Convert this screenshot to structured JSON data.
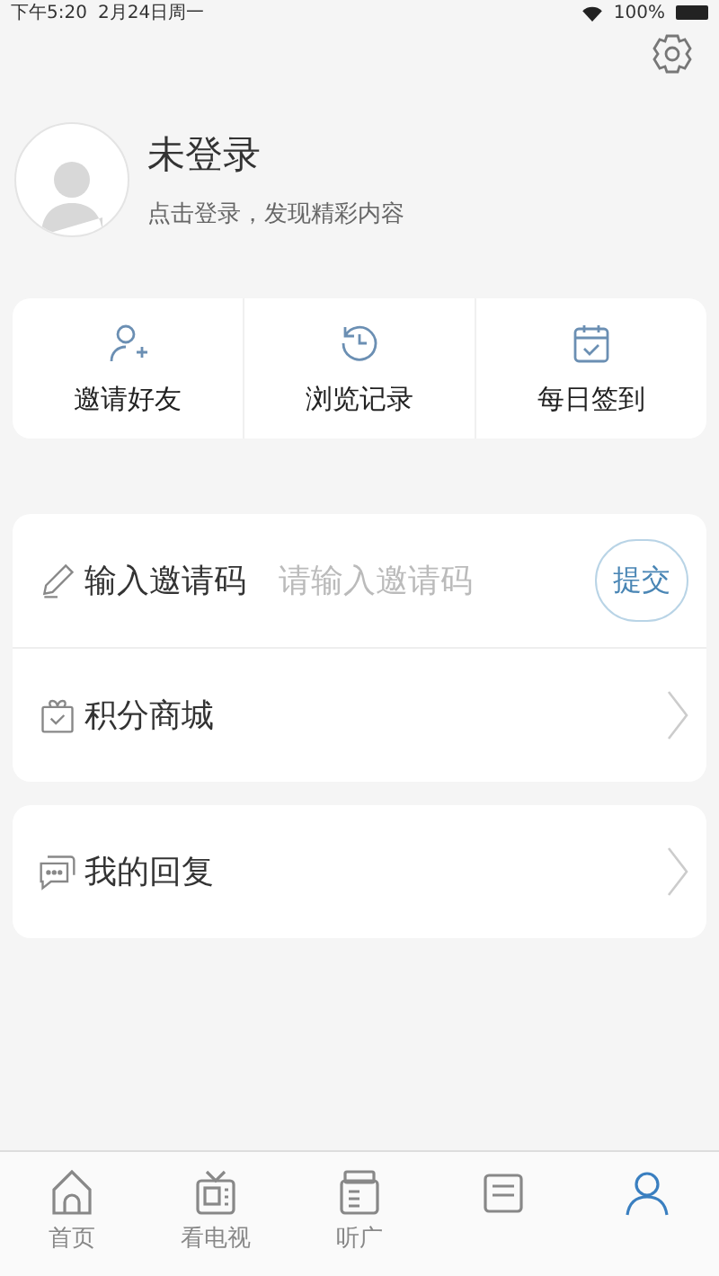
{
  "status_bar": {
    "time": "下午5:20",
    "date": "2月24日周一",
    "battery": "100%"
  },
  "profile": {
    "name": "未登录",
    "hint": "点击登录，发现精彩内容"
  },
  "quick_actions": [
    {
      "kind": "invite",
      "label": "邀请好友"
    },
    {
      "kind": "history",
      "label": "浏览记录"
    },
    {
      "kind": "checkin",
      "label": "每日签到"
    }
  ],
  "invite_code": {
    "label": "输入邀请码",
    "placeholder": "请输入邀请码",
    "button": "提交"
  },
  "menu_groups": [
    [
      {
        "kind": "shop",
        "label": "积分商城"
      }
    ],
    [
      {
        "kind": "reply",
        "label": "我的回复"
      }
    ]
  ],
  "tab_bar": [
    {
      "kind": "home",
      "label": "首页",
      "selected": false
    },
    {
      "kind": "tv",
      "label": "看电视",
      "selected": false
    },
    {
      "kind": "radio",
      "label": "听广",
      "selected": false
    },
    {
      "kind": "news",
      "selected": false
    },
    {
      "kind": "me",
      "selected": true
    }
  ]
}
